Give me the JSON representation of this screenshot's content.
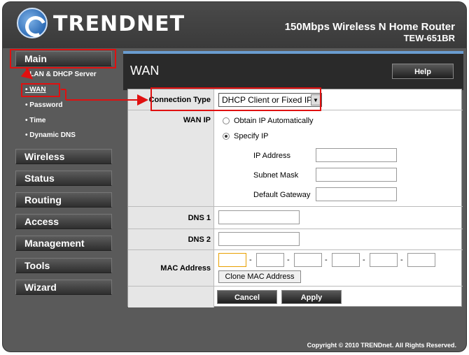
{
  "header": {
    "brand": "TRENDNET",
    "model_title": "150Mbps Wireless N Home Router",
    "model_number": "TEW-651BR"
  },
  "sidebar": {
    "main_label": "Main",
    "sub_items": [
      {
        "label": "LAN & DHCP Server"
      },
      {
        "label": "WAN",
        "active": true
      },
      {
        "label": "Password"
      },
      {
        "label": "Time"
      },
      {
        "label": "Dynamic DNS"
      }
    ],
    "menu_items": [
      {
        "label": "Wireless"
      },
      {
        "label": "Status"
      },
      {
        "label": "Routing"
      },
      {
        "label": "Access"
      },
      {
        "label": "Management"
      },
      {
        "label": "Tools"
      },
      {
        "label": "Wizard"
      }
    ]
  },
  "panel": {
    "title": "WAN",
    "help_label": "Help"
  },
  "form": {
    "connection_type_label": "Connection Type",
    "connection_type_value": "DHCP Client or Fixed IP",
    "wan_ip_label": "WAN IP",
    "obtain_ip_label": "Obtain IP Automatically",
    "specify_ip_label": "Specify IP",
    "ip_address_label": "IP Address",
    "subnet_mask_label": "Subnet Mask",
    "default_gateway_label": "Default Gateway",
    "dns1_label": "DNS 1",
    "dns2_label": "DNS 2",
    "mac_label": "MAC Address",
    "mac_separator": "-",
    "clone_mac_label": "Clone MAC Address",
    "cancel_label": "Cancel",
    "apply_label": "Apply"
  },
  "footer": {
    "copyright": "Copyright © 2010 TRENDnet. All Rights Reserved."
  },
  "colors": {
    "highlight": "#e01010",
    "accent": "#6a9cd0"
  }
}
